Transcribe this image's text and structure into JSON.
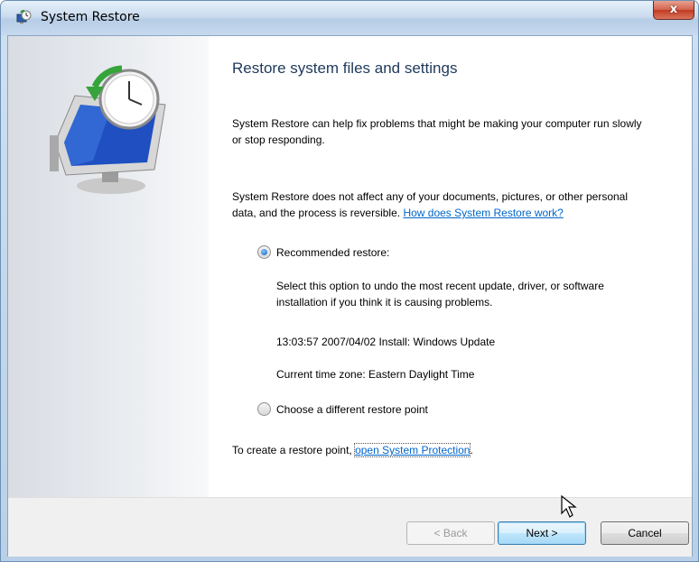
{
  "window": {
    "title": "System Restore",
    "close_glyph": "x"
  },
  "main": {
    "heading": "Restore system files and settings",
    "para1": "System Restore can help fix problems that might be making your computer run slowly or stop responding.",
    "para2_text": "System Restore does not affect any of your documents, pictures, or other personal data, and the process is reversible. ",
    "para2_link": "How does System Restore work?",
    "radio_recommended": {
      "label": "Recommended restore:",
      "checked": true
    },
    "recommended_desc": "Select this option to undo the most recent update, driver, or software installation if you think it is causing problems.",
    "restore_point": "13:03:57 2007/04/02 Install: Windows Update",
    "time_zone": "Current time zone: Eastern Daylight Time",
    "radio_choose": {
      "label": "Choose a different restore point",
      "checked": false
    },
    "create_text": "To create a restore point, ",
    "create_link": "open System Protection",
    "create_end": "."
  },
  "footer": {
    "back_label": "< Back",
    "next_label": "Next >",
    "cancel_label": "Cancel"
  },
  "icons": {
    "title_icon": "system-restore-icon",
    "hero_icon": "computer-clock-restore-icon"
  },
  "colors": {
    "heading": "#1e395b",
    "link": "#0066cc",
    "titlebar": "#cbdcef",
    "close": "#c33a22"
  }
}
